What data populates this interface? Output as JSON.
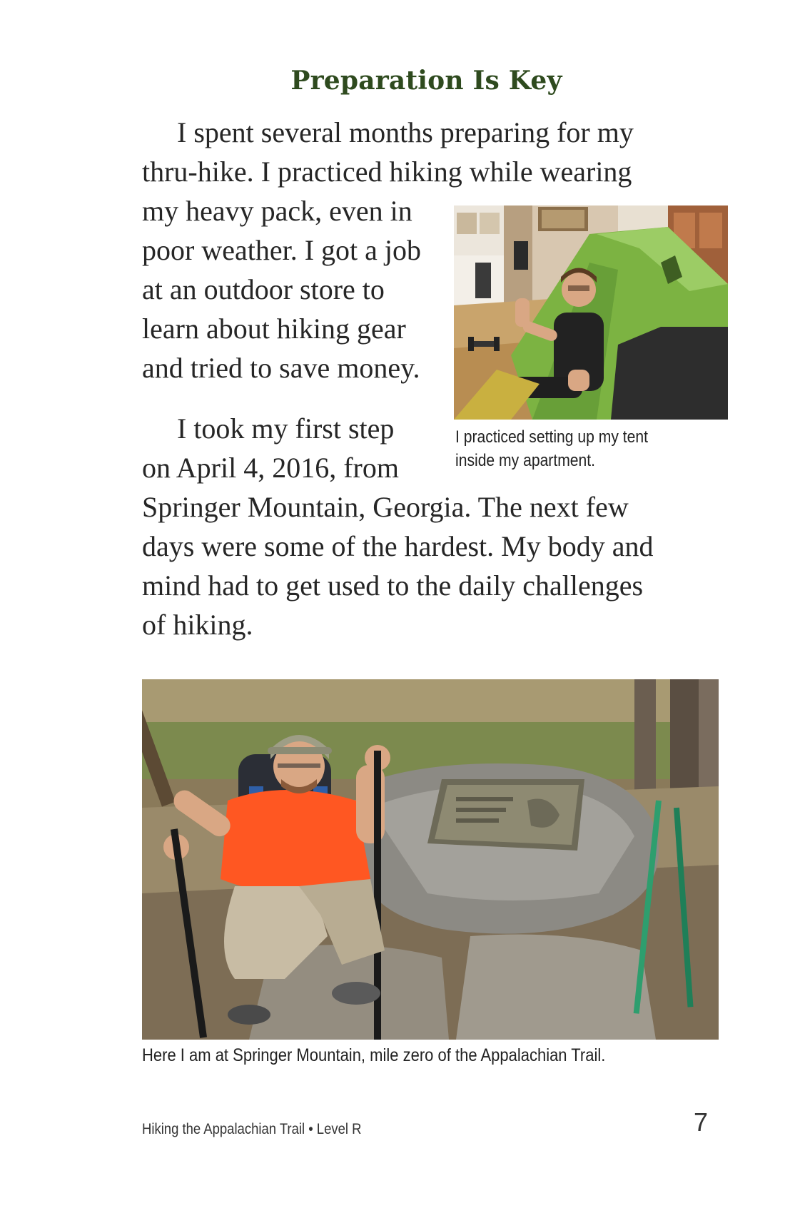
{
  "heading": "Preparation Is Key",
  "paragraph1": {
    "lines": [
      "I spent several months preparing for my",
      "thru-hike. I practiced hiking while wearing",
      "my heavy pack, even in",
      "poor weather. I got a job",
      "at an outdoor store to",
      "learn about hiking gear",
      "and tried to save money."
    ]
  },
  "paragraph2": {
    "lines": [
      "I took my first step",
      "on April 4, 2016, from",
      "Springer Mountain, Georgia. The next few",
      "days were some of the hardest. My body and",
      "mind had to get used to the daily challenges",
      "of hiking."
    ]
  },
  "photo_tent": {
    "caption_lines": [
      "I practiced setting up my tent",
      "inside my apartment."
    ]
  },
  "photo_trail": {
    "caption": "Here I am at Springer Mountain, mile zero of the Appalachian Trail."
  },
  "footer": {
    "book_title": "Hiking the Appalachian Trail • Level R",
    "page_number": "7"
  },
  "colors": {
    "heading": "#2e4a1e",
    "body_text": "#262626",
    "tent_green": "#7cb342",
    "shirt_orange": "#ff5722"
  }
}
